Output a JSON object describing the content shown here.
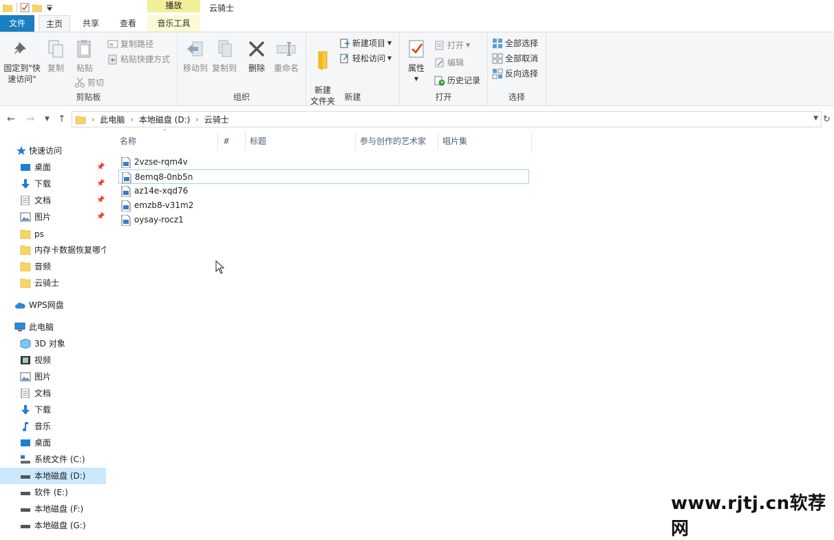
{
  "window": {
    "title": "云骑士",
    "context_tab": "播放"
  },
  "tabs": [
    "文件",
    "主页",
    "共享",
    "查看",
    "音乐工具"
  ],
  "ribbon": {
    "clipboard": {
      "label": "剪贴板",
      "pin_quick_access": "固定到\"快速访问\"",
      "copy": "复制",
      "paste": "粘贴",
      "copy_path": "复制路径",
      "paste_shortcut": "粘贴快捷方式",
      "cut": "剪切"
    },
    "organize": {
      "label": "组织",
      "move_to": "移动到",
      "copy_to": "复制到",
      "delete": "删除",
      "rename": "重命名"
    },
    "new": {
      "label": "新建",
      "new_folder": "新建\n文件夹",
      "new_item": "新建项目",
      "easy_access": "轻松访问"
    },
    "open": {
      "label": "打开",
      "properties": "属性",
      "open": "打开",
      "edit": "编辑",
      "history": "历史记录"
    },
    "select": {
      "label": "选择",
      "select_all": "全部选择",
      "select_none": "全部取消",
      "invert": "反向选择"
    }
  },
  "address": {
    "crumbs": [
      "此电脑",
      "本地磁盘 (D:)",
      "云骑士"
    ]
  },
  "sidebar": {
    "quick_access": "快速访问",
    "quick_items": [
      "桌面",
      "下载",
      "文档",
      "图片",
      "ps",
      "内存卡数据恢复哪个",
      "音频",
      "云骑士"
    ],
    "wps": "WPS网盘",
    "this_pc": "此电脑",
    "pc_items": [
      "3D 对象",
      "视频",
      "图片",
      "文档",
      "下载",
      "音乐",
      "桌面",
      "系统文件 (C:)",
      "本地磁盘 (D:)",
      "软件 (E:)",
      "本地磁盘 (F:)",
      "本地磁盘 (G:)"
    ]
  },
  "columns": [
    "名称",
    "#",
    "标题",
    "参与创作的艺术家",
    "唱片集"
  ],
  "files": [
    "2vzse-rqm4v",
    "8emq8-0nb5n",
    "az14e-xqd76",
    "emzb8-v31m2",
    "oysay-rocz1"
  ],
  "watermark": "www.rjtj.cn软荐网",
  "colors": {
    "file_tab": "#1a7fbf",
    "context_tab": "#f1ef9a",
    "selection": "#cce8ff",
    "focus_border": "#99d1ff"
  }
}
